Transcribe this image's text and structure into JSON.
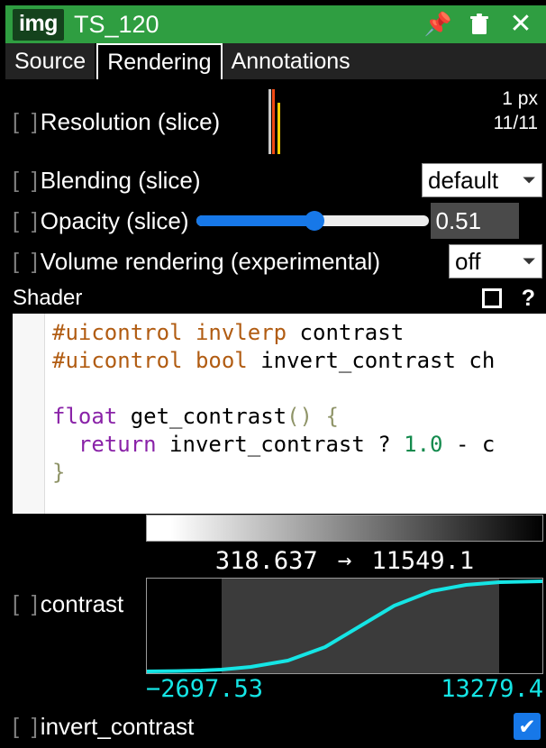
{
  "titlebar": {
    "badge": "img",
    "layer_name": "TS_120",
    "pin_icon": "pushpin-icon",
    "delete_icon": "trash-icon",
    "close_icon": "close-icon",
    "background_color": "#2f9e41"
  },
  "tabs": [
    {
      "label": "Source",
      "active": false
    },
    {
      "label": "Rendering",
      "active": true
    },
    {
      "label": "Annotations",
      "active": false
    }
  ],
  "controls": {
    "resolution": {
      "brackets": "[  ]",
      "label": "Resolution (slice)",
      "size_text": "1 px",
      "level_text": "11/11",
      "bar_colors": [
        "#c9c9c9",
        "#f04a14",
        "#ffd000"
      ]
    },
    "blending": {
      "brackets": "[  ]",
      "label": "Blending (slice)",
      "value": "default",
      "chevron": "chevron-down-icon"
    },
    "opacity": {
      "brackets": "[  ]",
      "label": "Opacity (slice)",
      "value": "0.51",
      "percent": 51,
      "accent_color": "#1778e8"
    },
    "volume_rendering": {
      "brackets": "[  ]",
      "label": "Volume rendering (experimental)",
      "value": "off",
      "chevron": "chevron-down-icon"
    }
  },
  "shader": {
    "title": "Shader",
    "expand_icon": "expand-icon",
    "help_icon": "help-icon",
    "code_lines": [
      [
        {
          "t": "#uicontrol invlerp",
          "c": "pre"
        },
        {
          "t": " contrast",
          "c": "id"
        }
      ],
      [
        {
          "t": "#uicontrol bool",
          "c": "pre"
        },
        {
          "t": " invert_contrast ch",
          "c": "id"
        }
      ],
      [
        {
          "t": "",
          "c": "id"
        }
      ],
      [
        {
          "t": "float",
          "c": "kw"
        },
        {
          "t": " get_contrast",
          "c": "id"
        },
        {
          "t": "() {",
          "c": "pun"
        }
      ],
      [
        {
          "t": "  ",
          "c": "id"
        },
        {
          "t": "return",
          "c": "kw"
        },
        {
          "t": " invert_contrast ? ",
          "c": "id"
        },
        {
          "t": "1.0",
          "c": "num"
        },
        {
          "t": " - c",
          "c": "id"
        }
      ],
      [
        {
          "t": "}",
          "c": "pun"
        }
      ]
    ]
  },
  "invlerp": {
    "colorbar_from": "#ffffff",
    "colorbar_to": "#000000",
    "range_min": "318.637",
    "range_arrow": "→",
    "range_max": "11549.1",
    "brackets": "[  ]",
    "label": "contrast",
    "bound_min": "−2697.53",
    "bound_max": "13279.4",
    "curve_color": "#15e5e5"
  },
  "invert_contrast": {
    "brackets": "[  ]",
    "label": "invert_contrast",
    "checked": true,
    "check_glyph": "✔",
    "accent_color": "#1778e8"
  },
  "chart_data": {
    "type": "line",
    "title": "contrast (invlerp transfer function)",
    "xlabel": "",
    "ylabel": "",
    "xlim": [
      -2697.53,
      13279.4
    ],
    "ylim": [
      0,
      1
    ],
    "grid": false,
    "legend": null,
    "window_range": [
      318.637,
      11549.1
    ],
    "x": [
      -2697.53,
      -1500,
      -500,
      318.637,
      1500,
      3000,
      4500,
      5900,
      7300,
      8800,
      10200,
      11549.1,
      12400,
      13279.4
    ],
    "y": [
      0.0,
      0.004,
      0.01,
      0.02,
      0.05,
      0.12,
      0.27,
      0.5,
      0.73,
      0.89,
      0.96,
      0.99,
      0.995,
      1.0
    ],
    "annotations": [
      {
        "text": "318.637",
        "role": "range-min"
      },
      {
        "text": "11549.1",
        "role": "range-max"
      },
      {
        "text": "−2697.53",
        "role": "domain-min"
      },
      {
        "text": "13279.4",
        "role": "domain-max"
      }
    ]
  }
}
